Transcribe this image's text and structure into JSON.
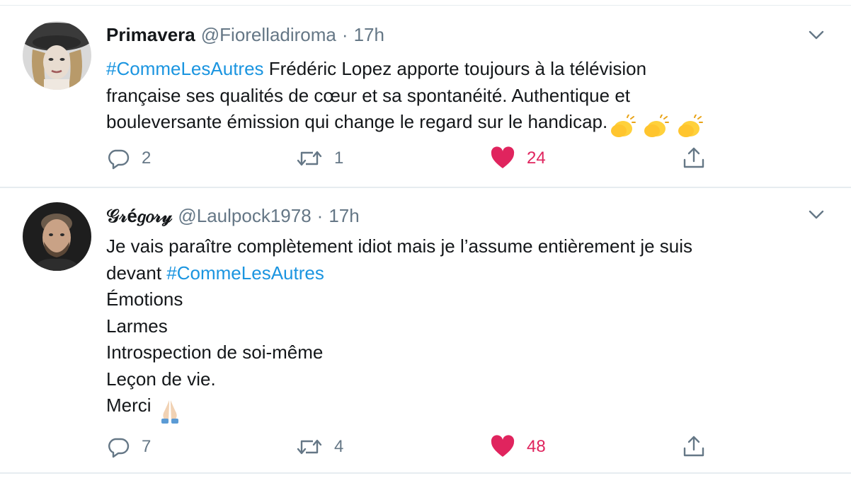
{
  "tweets": [
    {
      "display_name": "Primavera",
      "handle": "@Fiorelladiroma",
      "separator": "·",
      "time": "17h",
      "body_lines": [
        {
          "hashtag": "#CommeLesAutres",
          "text": " Frédéric Lopez apporte toujours à la télévision"
        },
        {
          "text": "française ses qualités de cœur et sa spontanéité. Authentique et"
        },
        {
          "text": "bouleversante émission qui change le regard sur le handicap."
        }
      ],
      "emoji": "clapping-hands x3",
      "replies": "2",
      "retweets": "1",
      "likes": "24"
    },
    {
      "display_name": "𝒢𝓇é𝑔𝑜𝓇𝓎",
      "handle": "@Laulpock1978",
      "separator": "·",
      "time": "17h",
      "body_lines": [
        {
          "text": "Je vais paraître complètement idiot mais je l’assume entièrement je suis"
        },
        {
          "text": "devant ",
          "hashtag": "#CommeLesAutres"
        },
        {
          "text": "Émotions"
        },
        {
          "text": "Larmes"
        },
        {
          "text": "Introspection de soi-même"
        },
        {
          "text": "Leçon de vie."
        },
        {
          "text": "Merci "
        }
      ],
      "emoji": "folded-hands",
      "replies": "7",
      "retweets": "4",
      "likes": "48"
    }
  ],
  "icons": {
    "reply": "reply-icon",
    "retweet": "retweet-icon",
    "like": "heart-icon",
    "share": "share-icon",
    "menu": "chevron-down-icon"
  },
  "colors": {
    "hashtag": "#1b95e0",
    "secondary_text": "#657786",
    "like": "#e0245e",
    "divider": "#e6ecf0"
  }
}
